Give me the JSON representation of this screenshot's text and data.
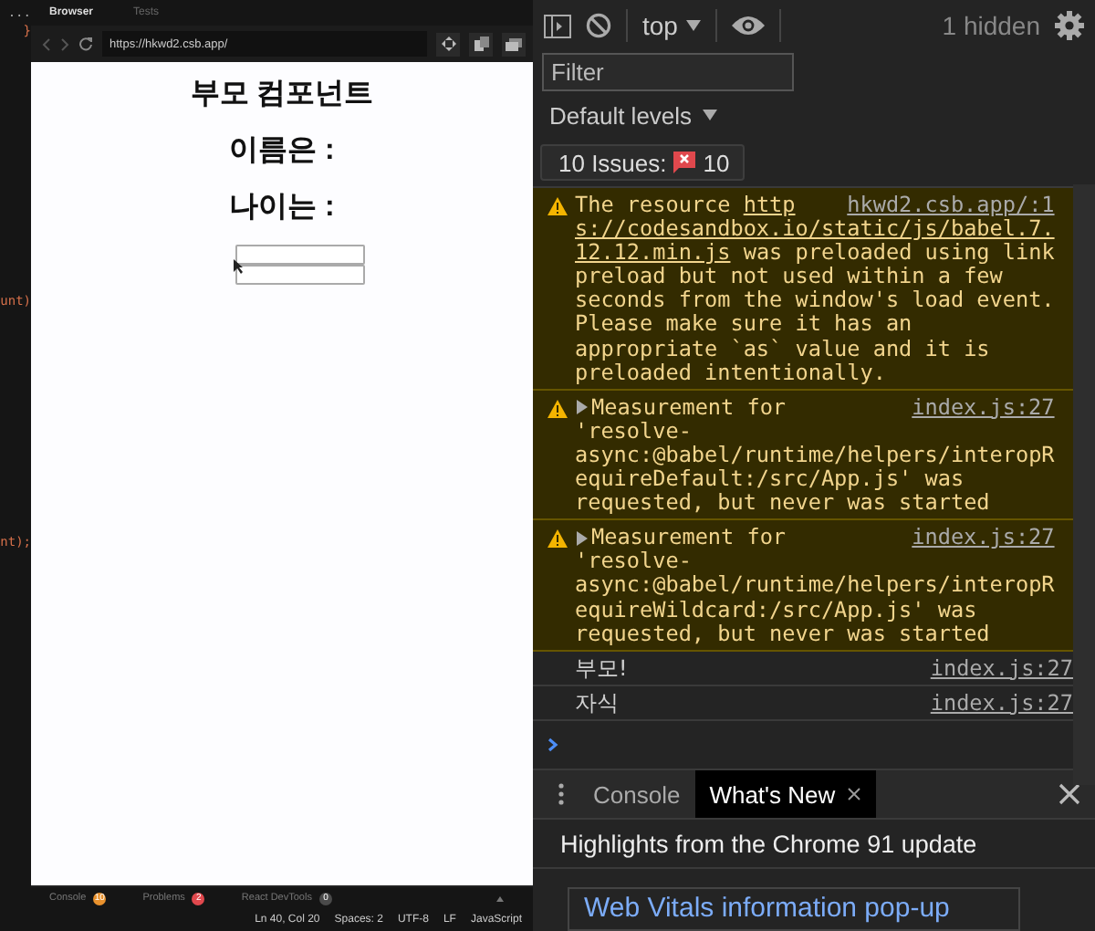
{
  "editor": {
    "fragments": [
      {
        "text": "...",
        "kind": "menu"
      },
      {
        "text": "}",
        "kind": "code"
      },
      {
        "text": "unt)",
        "kind": "code"
      },
      {
        "text": "nt);",
        "kind": "code"
      }
    ]
  },
  "browser": {
    "tabs": [
      {
        "label": "Browser",
        "selected": true
      },
      {
        "label": "Tests",
        "selected": false
      }
    ],
    "address": "https://hkwd2.csb.app/",
    "page": {
      "headings": [
        "부모 컴포넌트",
        "이름은 :",
        "나이는 :"
      ],
      "fields": [
        {
          "kind": "input"
        },
        {
          "kind": "input"
        }
      ]
    },
    "bottom_tabs": [
      {
        "label": "Console",
        "count": "10",
        "color": "#e8912d"
      },
      {
        "label": "Problems",
        "count": "2",
        "color": "#e0484d"
      },
      {
        "label": "React DevTools",
        "count": "0",
        "color": "#4a4a4a"
      }
    ]
  },
  "status_bar": [
    "Ln 40, Col 20",
    "Spaces: 2",
    "UTF-8",
    "LF",
    "JavaScript"
  ],
  "devtools": {
    "context": "top",
    "hidden": "1 hidden",
    "filter_placeholder": "Filter",
    "levels": "Default levels",
    "issues": {
      "label": "10 Issues:",
      "count": "10"
    },
    "messages": [
      {
        "kind": "warning",
        "expandable": false,
        "lines": [
          [
            {
              "text": "The resource "
            },
            {
              "text": "http",
              "link": true
            }
          ],
          [
            {
              "text": "s://codesandbox.io/static/js/babel.7.",
              "link": true
            }
          ],
          [
            {
              "text": "12.12.min.js",
              "link": true
            },
            {
              "text": " was preloaded using link"
            }
          ],
          [
            {
              "text": "preload but not used within a few"
            }
          ],
          [
            {
              "text": "seconds from the window's load event."
            }
          ],
          [
            {
              "text": "Please make sure it has an"
            }
          ],
          [
            {
              "text": "appropriate `as` value and it is"
            }
          ],
          [
            {
              "text": "preloaded intentionally."
            }
          ]
        ],
        "source": "hkwd2.csb.app/:1"
      },
      {
        "kind": "warning",
        "expandable": true,
        "lines": [
          [
            {
              "text": "Measurement for"
            }
          ],
          [
            {
              "text": "'resolve-"
            }
          ],
          [
            {
              "text": "async:@babel/runtime/helpers/interopR"
            }
          ],
          [
            {
              "text": "equireDefault:/src/App.js' was"
            }
          ],
          [
            {
              "text": "requested, but never was started"
            }
          ]
        ],
        "source": "index.js:27"
      },
      {
        "kind": "warning",
        "expandable": true,
        "lines": [
          [
            {
              "text": "Measurement for"
            }
          ],
          [
            {
              "text": "'resolve-"
            }
          ],
          [
            {
              "text": "async:@babel/runtime/helpers/interopR"
            }
          ],
          [
            {
              "text": "equireWildcard:/src/App.js' was"
            }
          ],
          [
            {
              "text": "requested, but never was started"
            }
          ]
        ],
        "source": "index.js:27"
      },
      {
        "kind": "log",
        "expandable": false,
        "lines": [
          [
            {
              "text": "부모!"
            }
          ]
        ],
        "source": "index.js:27"
      },
      {
        "kind": "log",
        "expandable": false,
        "lines": [
          [
            {
              "text": "자식"
            }
          ]
        ],
        "source": "index.js:27"
      }
    ],
    "drawer": {
      "tabs": [
        {
          "label": "Console",
          "selected": false,
          "closable": false
        },
        {
          "label": "What's New",
          "selected": true,
          "closable": true
        }
      ],
      "headline": "Highlights from the Chrome 91 update",
      "card_title": "Web Vitals information pop-up"
    }
  }
}
